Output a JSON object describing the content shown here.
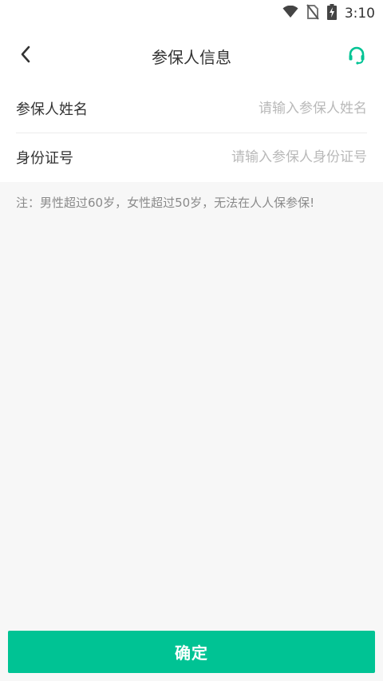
{
  "status_bar": {
    "time": "3:10",
    "icons": [
      "wifi-icon",
      "no-sim-icon",
      "battery-charging-icon"
    ]
  },
  "nav": {
    "title": "参保人信息",
    "back_icon": "chevron-left-icon",
    "support_icon": "headset-icon"
  },
  "form": {
    "name": {
      "label": "参保人姓名",
      "value": "",
      "placeholder": "请输入参保人姓名"
    },
    "id_number": {
      "label": "身份证号",
      "value": "",
      "placeholder": "请输入参保人身份证号"
    }
  },
  "note": "注：男性超过60岁，女性超过50岁，无法在人人保参保!",
  "confirm_button": {
    "label": "确定"
  },
  "colors": {
    "accent": "#00c394",
    "page_bg": "#f7f7f7",
    "card_bg": "#ffffff",
    "placeholder": "#b9b9b9",
    "note_text": "#8a8a8a"
  }
}
